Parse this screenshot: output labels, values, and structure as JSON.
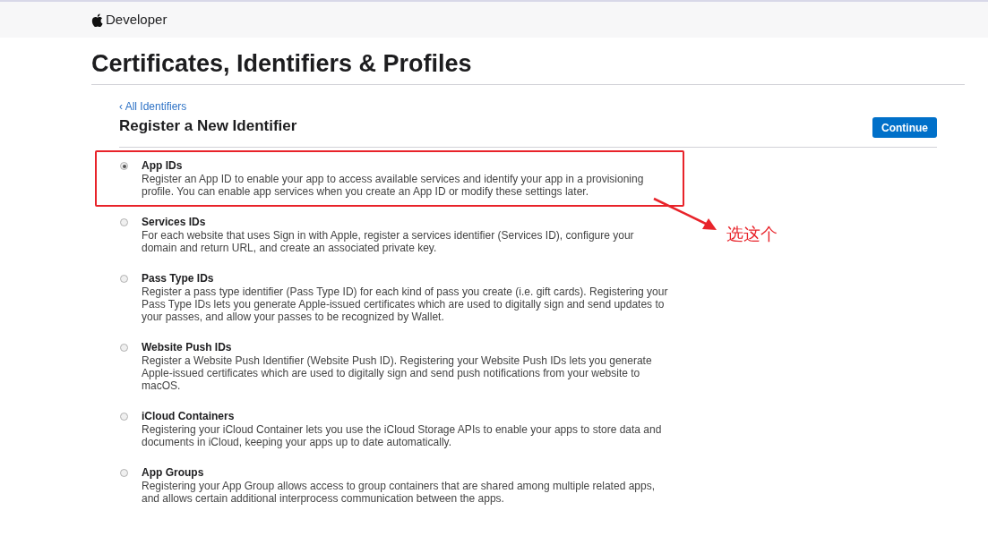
{
  "header": {
    "brand": "Developer"
  },
  "page_title": "Certificates, Identifiers & Profiles",
  "back_link": "‹ All Identifiers",
  "section_title": "Register a New Identifier",
  "continue_button": "Continue",
  "options": [
    {
      "title": "App IDs",
      "description": "Register an App ID to enable your app to access available services and identify your app in a provisioning profile. You can enable app services when you create an App ID or modify these settings later.",
      "selected": true,
      "highlighted": true
    },
    {
      "title": "Services IDs",
      "description": "For each website that uses Sign in with Apple, register a services identifier (Services ID), configure your domain and return URL, and create an associated private key.",
      "selected": false,
      "highlighted": false
    },
    {
      "title": "Pass Type IDs",
      "description": "Register a pass type identifier (Pass Type ID) for each kind of pass you create (i.e. gift cards). Registering your Pass Type IDs lets you generate Apple-issued certificates which are used to digitally sign and send updates to your passes, and allow your passes to be recognized by Wallet.",
      "selected": false,
      "highlighted": false
    },
    {
      "title": "Website Push IDs",
      "description": "Register a Website Push Identifier (Website Push ID). Registering your Website Push IDs lets you generate Apple-issued certificates which are used to digitally sign and send push notifications from your website to macOS.",
      "selected": false,
      "highlighted": false
    },
    {
      "title": "iCloud Containers",
      "description": "Registering your iCloud Container lets you use the iCloud Storage APIs to enable your apps to store data and documents in iCloud, keeping your apps up to date automatically.",
      "selected": false,
      "highlighted": false
    },
    {
      "title": "App Groups",
      "description": "Registering your App Group allows access to group containers that are shared among multiple related apps, and allows certain additional interprocess communication between the apps.",
      "selected": false,
      "highlighted": false
    }
  ],
  "annotation": {
    "text": "选这个"
  }
}
